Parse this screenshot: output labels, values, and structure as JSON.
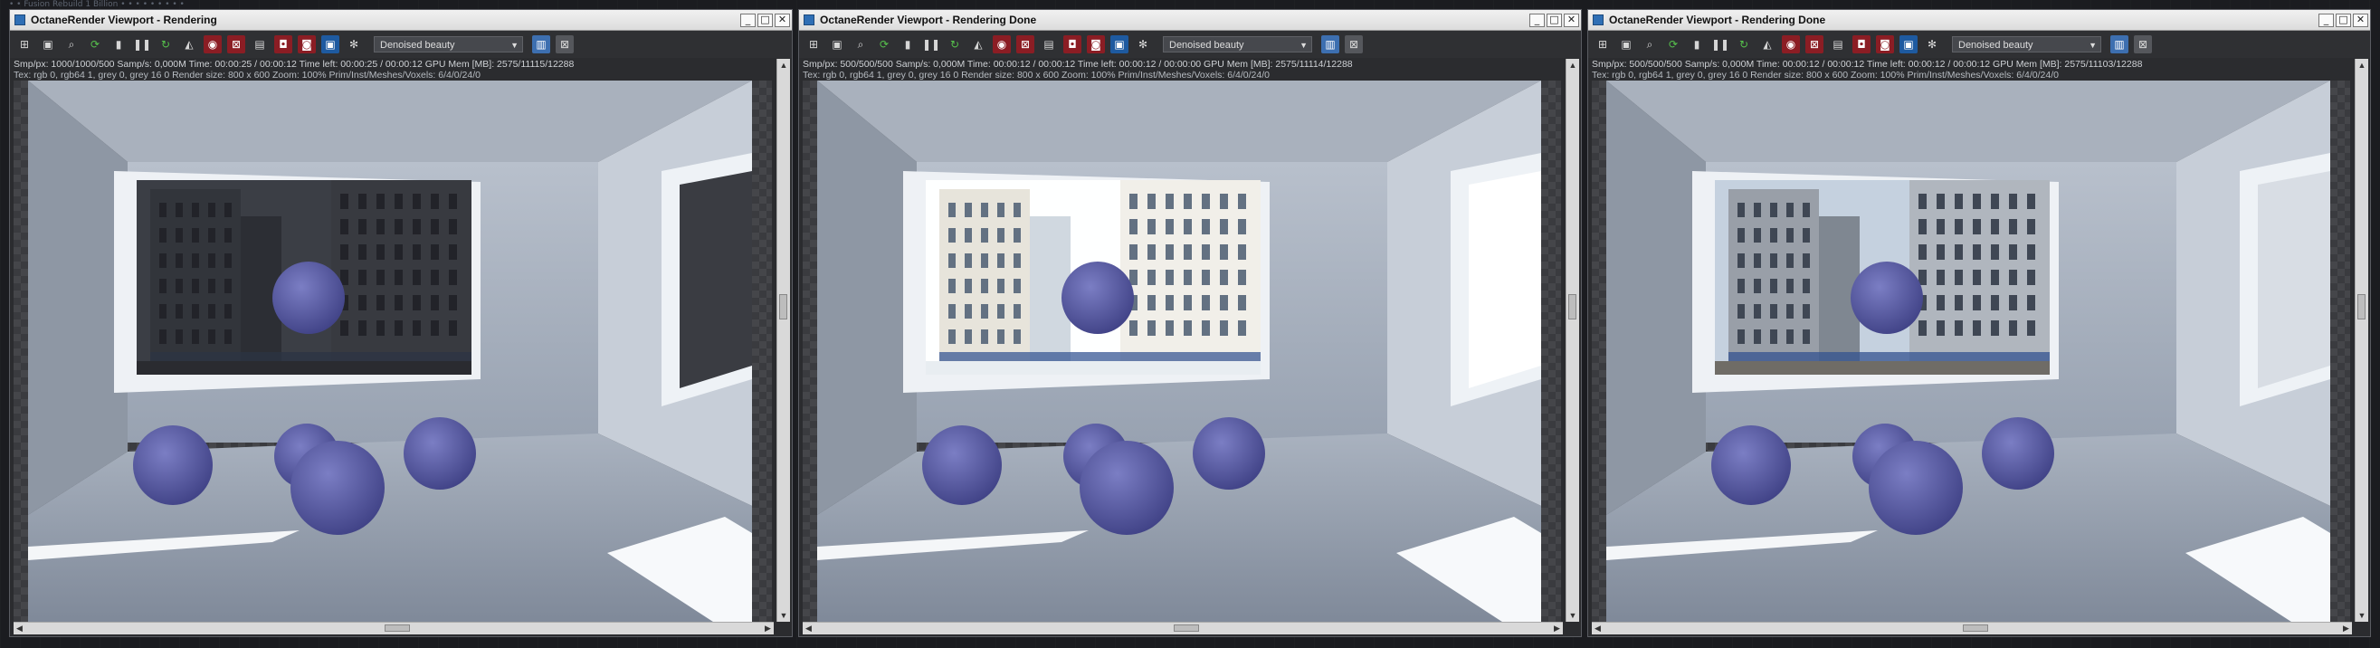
{
  "top_strip_text": "• • Fusion Rebuild 1 Billion • • • • • • • • •",
  "windows": [
    {
      "title": "OctaneRender Viewport - Rendering",
      "render_mode": "Denoised beauty",
      "status_line1": "Smp/px: 1000/1000/500   Samp/s: 0,000M   Time: 00:00:25 / 00:00:12   Time left: 00:00:25 / 00:00:12   GPU Mem [MB]: 2575/11115/12288",
      "status_line2": "Tex: rgb 0, rgb64 1, grey 0, grey 16 0    Render size: 800 x 600    Zoom: 100%    Prim/Inst/Meshes/Voxels: 6/4/0/24/0",
      "env": "dark"
    },
    {
      "title": "OctaneRender Viewport - Rendering Done",
      "render_mode": "Denoised beauty",
      "status_line1": "Smp/px: 500/500/500   Samp/s: 0,000M   Time: 00:00:12 / 00:00:12   Time left: 00:00:12 / 00:00:00   GPU Mem [MB]: 2575/11114/12288",
      "status_line2": "Tex: rgb 0, rgb64 1, grey 0, grey 16 0    Render size: 800 x 600    Zoom: 100%    Prim/Inst/Meshes/Voxels: 6/4/0/24/0",
      "env": "bright"
    },
    {
      "title": "OctaneRender Viewport - Rendering Done",
      "render_mode": "Denoised beauty",
      "status_line1": "Smp/px: 500/500/500   Samp/s: 0,000M   Time: 00:00:12 / 00:00:12   Time left: 00:00:12 / 00:00:12   GPU Mem [MB]: 2575/11103/12288",
      "status_line2": "Tex: rgb 0, rgb64 1, grey 0, grey 16 0    Render size: 800 x 600    Zoom: 100%    Prim/Inst/Meshes/Voxels: 6/4/0/24/0",
      "env": "normal"
    }
  ],
  "title_controls": {
    "minimize": "_",
    "maximize": "□",
    "close": "✕"
  },
  "toolbar_icons": [
    "open-icon",
    "save-icon",
    "zoom-icon",
    "refresh-icon",
    "lock-icon",
    "pause-icon",
    "restart-icon",
    "clay-icon",
    "color-icon",
    "region-icon",
    "focus-icon",
    "material-icon",
    "settings-icon",
    "film-icon",
    "gear-icon",
    "view-icon",
    "close-icon"
  ],
  "colors": {
    "title_bg": "#e6e6e6",
    "toolbar_bg": "#2f3033",
    "sphere": "#5a5c9e",
    "wall": "#c5ccd6",
    "floor": "#8d97a6"
  }
}
